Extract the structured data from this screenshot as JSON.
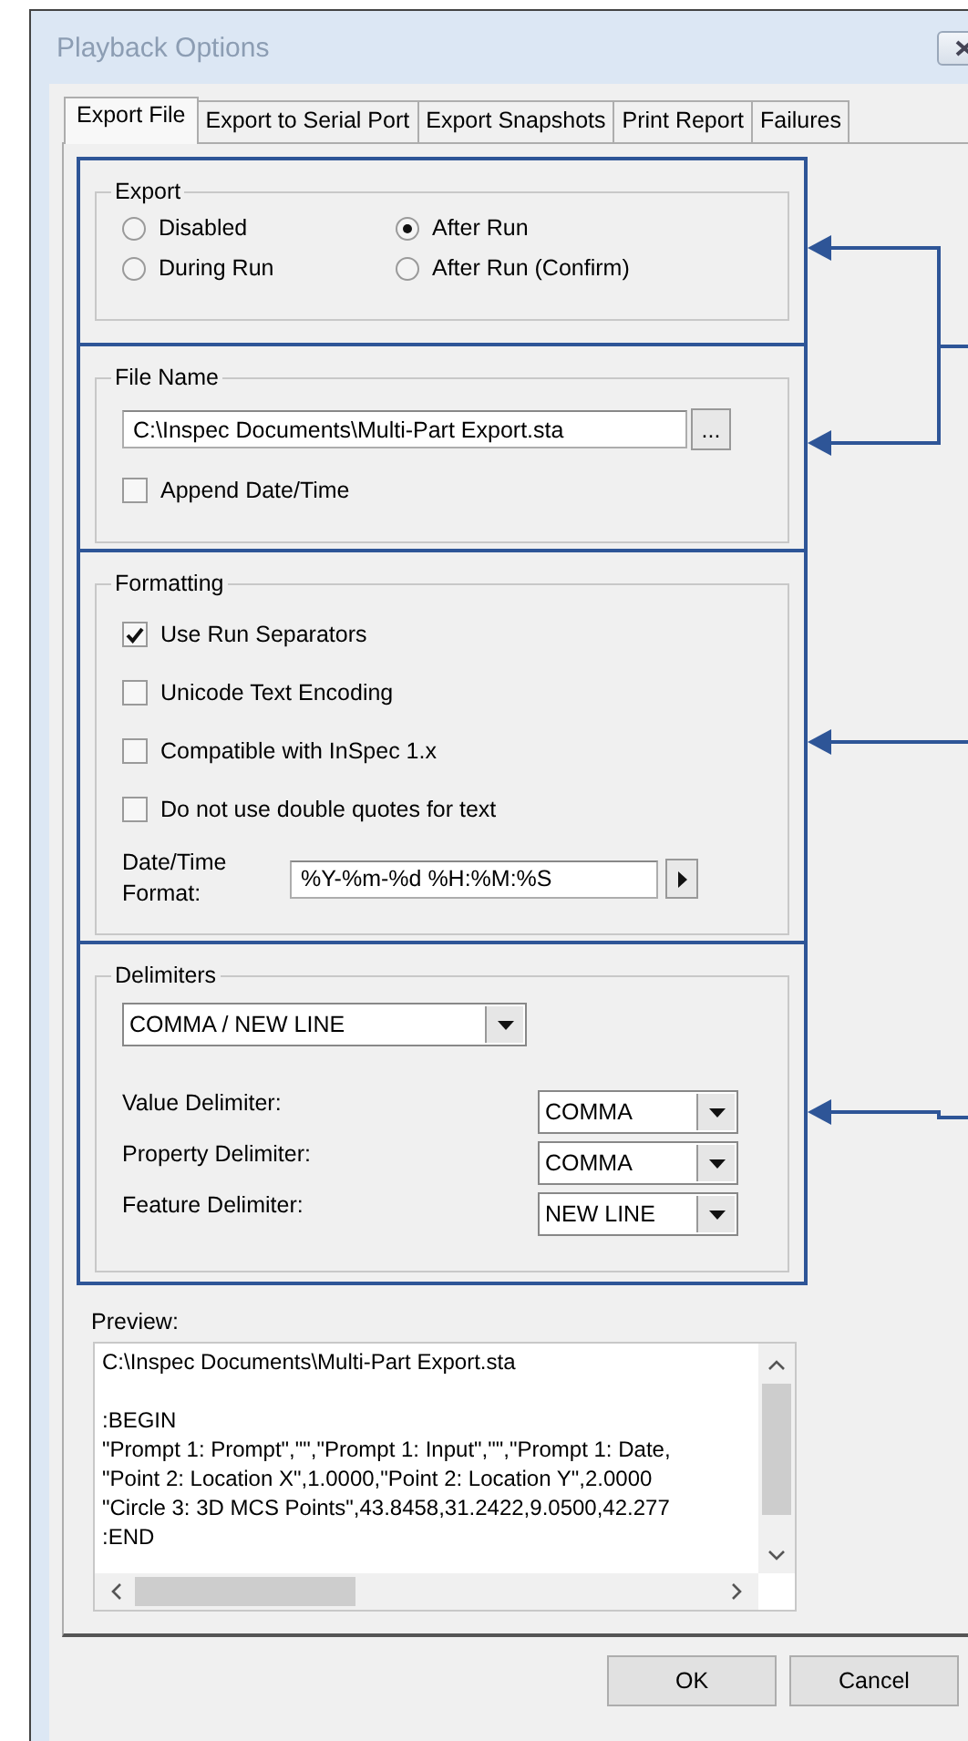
{
  "window": {
    "title": "Playback Options"
  },
  "tabs": [
    {
      "label": "Export File",
      "selected": true
    },
    {
      "label": "Export to Serial Port",
      "selected": false
    },
    {
      "label": "Export Snapshots",
      "selected": false
    },
    {
      "label": "Print Report",
      "selected": false
    },
    {
      "label": "Failures",
      "selected": false
    }
  ],
  "sections": [
    {
      "kind": "radios",
      "title": "Export",
      "options": [
        {
          "label": "Disabled",
          "selected": false
        },
        {
          "label": "After Run",
          "selected": true
        },
        {
          "label": "During Run",
          "selected": false
        },
        {
          "label": "After Run (Confirm)",
          "selected": false
        }
      ]
    },
    {
      "kind": "file",
      "title": "File Name",
      "value": "C:\\Inspec Documents\\Multi-Part Export.sta",
      "browse": "...",
      "checkbox": {
        "label": "Append Date/Time",
        "checked": false
      }
    },
    {
      "kind": "checks",
      "title": "Formatting",
      "options": [
        {
          "label": "Use Run Separators",
          "checked": true
        },
        {
          "label": "Unicode Text Encoding",
          "checked": false
        },
        {
          "label": "Compatible with InSpec 1.x",
          "checked": false
        },
        {
          "label": "Do not use double quotes for text",
          "checked": false
        }
      ],
      "format_label": "Date/Time Format:",
      "format_value": "%Y-%m-%d %H:%M:%S"
    },
    {
      "kind": "delimiters",
      "title": "Delimiters",
      "preset": "COMMA / NEW LINE",
      "fields": [
        {
          "label": "Value Delimiter:",
          "value": "COMMA"
        },
        {
          "label": "Property Delimiter:",
          "value": "COMMA"
        },
        {
          "label": "Feature Delimiter:",
          "value": "NEW LINE"
        }
      ]
    }
  ],
  "preview": {
    "label": "Preview:",
    "path": "C:\\Inspec Documents\\Multi-Part Export.sta",
    "lines": [
      ":BEGIN",
      "\"Prompt 1: Prompt\",\"\",\"Prompt 1: Input\",\"\",\"Prompt 1: Date,",
      "\"Point 2: Location X\",1.0000,\"Point 2: Location Y\",2.0000",
      "\"Circle 3: 3D MCS Points\",43.8458,31.2422,9.0500,42.277",
      ":END"
    ]
  },
  "buttons": [
    "OK",
    "Cancel"
  ]
}
